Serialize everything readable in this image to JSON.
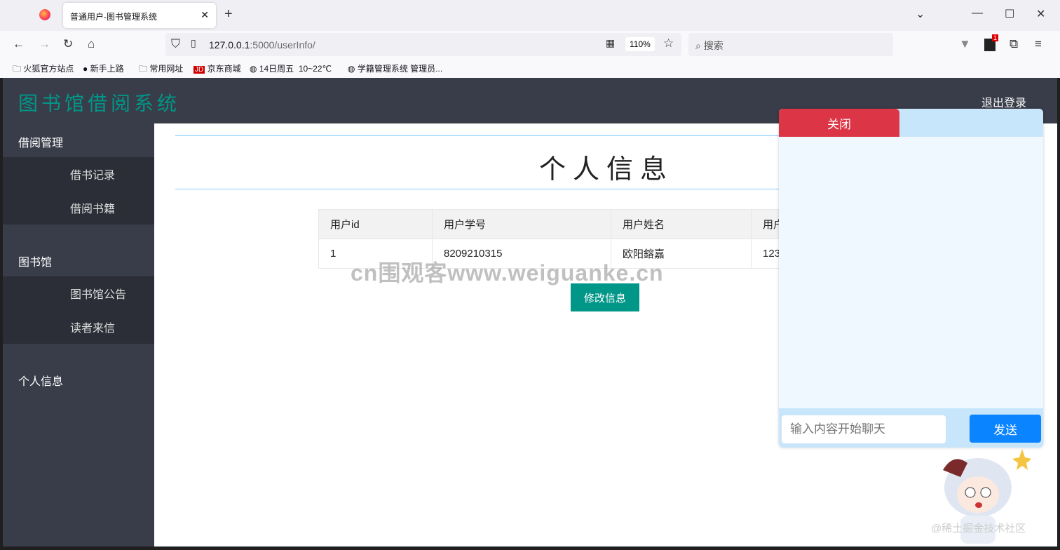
{
  "browser": {
    "tab_title": "普通用户-图书管理系统",
    "url_host": "127.0.0.1",
    "url_rest": ":5000/userInfo/",
    "zoom": "110%",
    "search_placeholder": "搜索",
    "ext_badge": "1",
    "bookmarks": [
      "火狐官方站点",
      "新手上路",
      "常用网址",
      "京东商城",
      "14日周五  10~22℃",
      "学籍管理系统 管理员..."
    ]
  },
  "app": {
    "logo": "图书馆借阅系统",
    "logout": "退出登录",
    "accent": "#009688"
  },
  "sidebar": {
    "groups": [
      {
        "label": "借阅管理",
        "items": [
          "借书记录",
          "借阅书籍"
        ]
      },
      {
        "label": "图书馆",
        "items": [
          "图书馆公告",
          "读者来信"
        ]
      },
      {
        "label": "个人信息",
        "items": []
      }
    ]
  },
  "main": {
    "title": "个人信息",
    "table": {
      "headers": [
        "用户id",
        "用户学号",
        "用户姓名",
        "用户"
      ],
      "rows": [
        [
          "1",
          "8209210315",
          "欧阳鎔嘉",
          "123"
        ]
      ]
    },
    "edit_button": "修改信息"
  },
  "chat": {
    "close": "关闭",
    "placeholder": "输入内容开始聊天",
    "send": "发送"
  },
  "watermarks": {
    "center": "cn围观客www.weiguanke.cn",
    "corner": "@稀土掘金技术社区"
  }
}
